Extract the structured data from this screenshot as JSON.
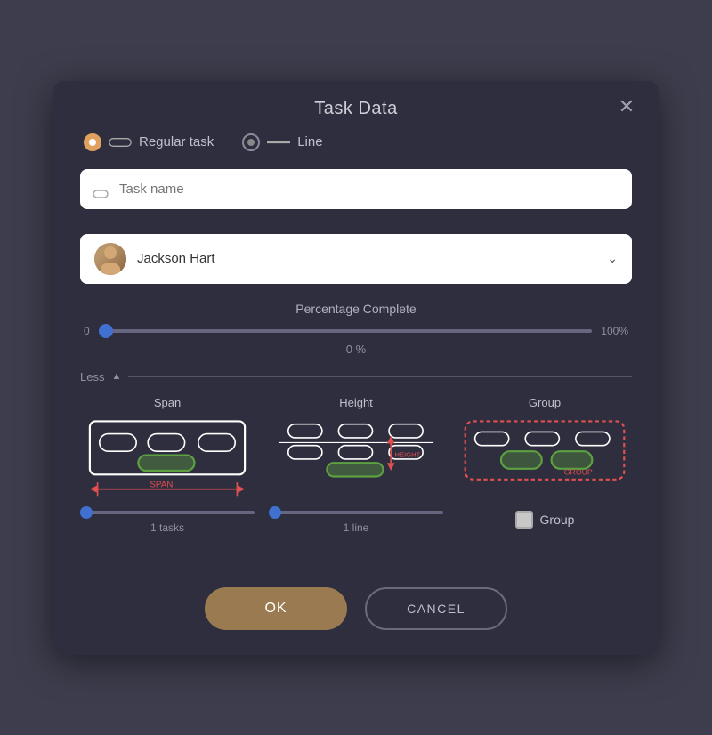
{
  "dialog": {
    "title": "Task Data",
    "close_label": "✕"
  },
  "radio": {
    "options": [
      {
        "id": "regular",
        "label": "Regular task",
        "selected": true
      },
      {
        "id": "line",
        "label": "Line",
        "selected": false
      }
    ]
  },
  "task_name_placeholder": "Task name",
  "assignee": {
    "name": "Jackson Hart"
  },
  "percentage": {
    "label": "Percentage Complete",
    "min": "0",
    "max": "100%",
    "value": "0 %",
    "slider_val": 0
  },
  "less_section": {
    "label": "Less",
    "chevron": "▲"
  },
  "columns": [
    {
      "title": "Span",
      "slider_value": "1 tasks"
    },
    {
      "title": "Height",
      "slider_value": "1 line"
    },
    {
      "title": "Group",
      "checkbox_label": "Group"
    }
  ],
  "footer": {
    "ok_label": "OK",
    "cancel_label": "CANCEL"
  }
}
